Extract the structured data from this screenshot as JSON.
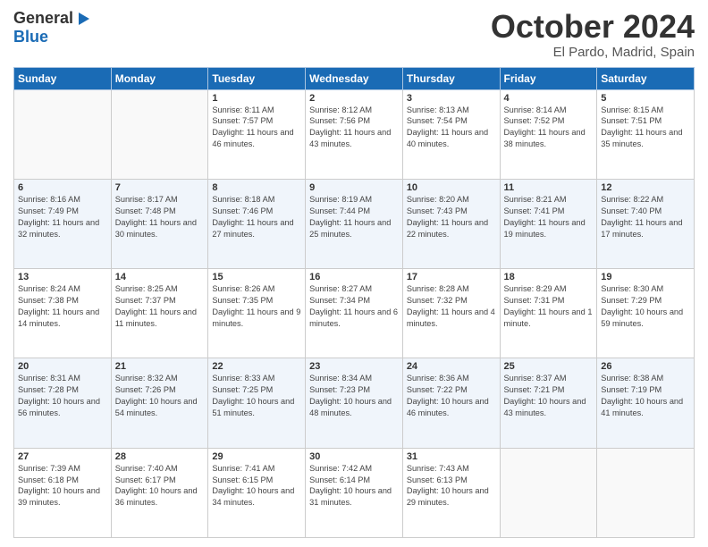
{
  "header": {
    "logo_line1": "General",
    "logo_line2": "Blue",
    "month": "October 2024",
    "location": "El Pardo, Madrid, Spain"
  },
  "weekdays": [
    "Sunday",
    "Monday",
    "Tuesday",
    "Wednesday",
    "Thursday",
    "Friday",
    "Saturday"
  ],
  "weeks": [
    [
      {
        "day": "",
        "info": ""
      },
      {
        "day": "",
        "info": ""
      },
      {
        "day": "1",
        "info": "Sunrise: 8:11 AM\nSunset: 7:57 PM\nDaylight: 11 hours and 46 minutes."
      },
      {
        "day": "2",
        "info": "Sunrise: 8:12 AM\nSunset: 7:56 PM\nDaylight: 11 hours and 43 minutes."
      },
      {
        "day": "3",
        "info": "Sunrise: 8:13 AM\nSunset: 7:54 PM\nDaylight: 11 hours and 40 minutes."
      },
      {
        "day": "4",
        "info": "Sunrise: 8:14 AM\nSunset: 7:52 PM\nDaylight: 11 hours and 38 minutes."
      },
      {
        "day": "5",
        "info": "Sunrise: 8:15 AM\nSunset: 7:51 PM\nDaylight: 11 hours and 35 minutes."
      }
    ],
    [
      {
        "day": "6",
        "info": "Sunrise: 8:16 AM\nSunset: 7:49 PM\nDaylight: 11 hours and 32 minutes."
      },
      {
        "day": "7",
        "info": "Sunrise: 8:17 AM\nSunset: 7:48 PM\nDaylight: 11 hours and 30 minutes."
      },
      {
        "day": "8",
        "info": "Sunrise: 8:18 AM\nSunset: 7:46 PM\nDaylight: 11 hours and 27 minutes."
      },
      {
        "day": "9",
        "info": "Sunrise: 8:19 AM\nSunset: 7:44 PM\nDaylight: 11 hours and 25 minutes."
      },
      {
        "day": "10",
        "info": "Sunrise: 8:20 AM\nSunset: 7:43 PM\nDaylight: 11 hours and 22 minutes."
      },
      {
        "day": "11",
        "info": "Sunrise: 8:21 AM\nSunset: 7:41 PM\nDaylight: 11 hours and 19 minutes."
      },
      {
        "day": "12",
        "info": "Sunrise: 8:22 AM\nSunset: 7:40 PM\nDaylight: 11 hours and 17 minutes."
      }
    ],
    [
      {
        "day": "13",
        "info": "Sunrise: 8:24 AM\nSunset: 7:38 PM\nDaylight: 11 hours and 14 minutes."
      },
      {
        "day": "14",
        "info": "Sunrise: 8:25 AM\nSunset: 7:37 PM\nDaylight: 11 hours and 11 minutes."
      },
      {
        "day": "15",
        "info": "Sunrise: 8:26 AM\nSunset: 7:35 PM\nDaylight: 11 hours and 9 minutes."
      },
      {
        "day": "16",
        "info": "Sunrise: 8:27 AM\nSunset: 7:34 PM\nDaylight: 11 hours and 6 minutes."
      },
      {
        "day": "17",
        "info": "Sunrise: 8:28 AM\nSunset: 7:32 PM\nDaylight: 11 hours and 4 minutes."
      },
      {
        "day": "18",
        "info": "Sunrise: 8:29 AM\nSunset: 7:31 PM\nDaylight: 11 hours and 1 minute."
      },
      {
        "day": "19",
        "info": "Sunrise: 8:30 AM\nSunset: 7:29 PM\nDaylight: 10 hours and 59 minutes."
      }
    ],
    [
      {
        "day": "20",
        "info": "Sunrise: 8:31 AM\nSunset: 7:28 PM\nDaylight: 10 hours and 56 minutes."
      },
      {
        "day": "21",
        "info": "Sunrise: 8:32 AM\nSunset: 7:26 PM\nDaylight: 10 hours and 54 minutes."
      },
      {
        "day": "22",
        "info": "Sunrise: 8:33 AM\nSunset: 7:25 PM\nDaylight: 10 hours and 51 minutes."
      },
      {
        "day": "23",
        "info": "Sunrise: 8:34 AM\nSunset: 7:23 PM\nDaylight: 10 hours and 48 minutes."
      },
      {
        "day": "24",
        "info": "Sunrise: 8:36 AM\nSunset: 7:22 PM\nDaylight: 10 hours and 46 minutes."
      },
      {
        "day": "25",
        "info": "Sunrise: 8:37 AM\nSunset: 7:21 PM\nDaylight: 10 hours and 43 minutes."
      },
      {
        "day": "26",
        "info": "Sunrise: 8:38 AM\nSunset: 7:19 PM\nDaylight: 10 hours and 41 minutes."
      }
    ],
    [
      {
        "day": "27",
        "info": "Sunrise: 7:39 AM\nSunset: 6:18 PM\nDaylight: 10 hours and 39 minutes."
      },
      {
        "day": "28",
        "info": "Sunrise: 7:40 AM\nSunset: 6:17 PM\nDaylight: 10 hours and 36 minutes."
      },
      {
        "day": "29",
        "info": "Sunrise: 7:41 AM\nSunset: 6:15 PM\nDaylight: 10 hours and 34 minutes."
      },
      {
        "day": "30",
        "info": "Sunrise: 7:42 AM\nSunset: 6:14 PM\nDaylight: 10 hours and 31 minutes."
      },
      {
        "day": "31",
        "info": "Sunrise: 7:43 AM\nSunset: 6:13 PM\nDaylight: 10 hours and 29 minutes."
      },
      {
        "day": "",
        "info": ""
      },
      {
        "day": "",
        "info": ""
      }
    ]
  ]
}
